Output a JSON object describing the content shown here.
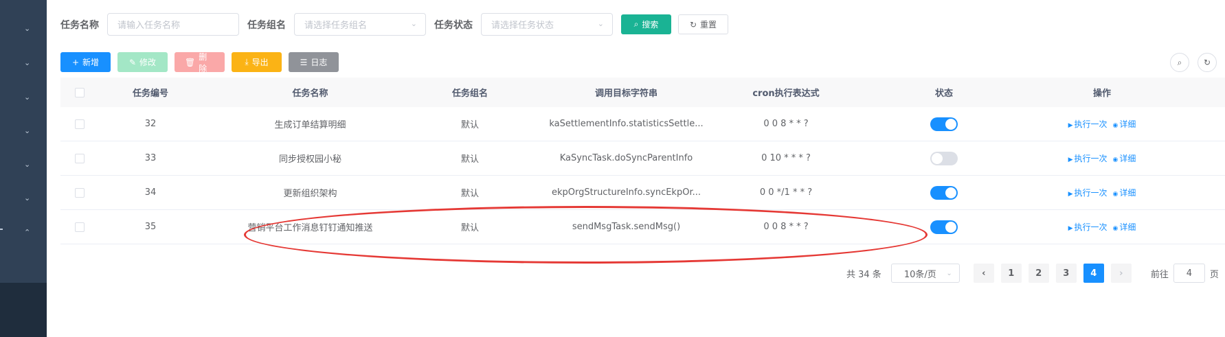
{
  "search": {
    "task_name_label": "任务名称",
    "task_name_placeholder": "请输入任务名称",
    "task_group_label": "任务组名",
    "task_group_placeholder": "请选择任务组名",
    "task_status_label": "任务状态",
    "task_status_placeholder": "请选择任务状态",
    "search_button": "搜索",
    "reset_button": "重置"
  },
  "toolbar": {
    "add": "新增",
    "edit": "修改",
    "delete": "删除",
    "export": "导出",
    "log": "日志"
  },
  "table": {
    "headers": [
      "任务编号",
      "任务名称",
      "任务组名",
      "调用目标字符串",
      "cron执行表达式",
      "状态",
      "操作"
    ],
    "rows": [
      {
        "id": "32",
        "name": "生成订单结算明细",
        "group": "默认",
        "target": "kaSettlementInfo.statisticsSettle...",
        "cron": "0 0 8 * * ?",
        "enabled": true
      },
      {
        "id": "33",
        "name": "同步授权园小秘",
        "group": "默认",
        "target": "KaSyncTask.doSyncParentInfo",
        "cron": "0 10 * * * ?",
        "enabled": false
      },
      {
        "id": "34",
        "name": "更新组织架构",
        "group": "默认",
        "target": "ekpOrgStructureInfo.syncEkpOr...",
        "cron": "0 0 */1 * * ?",
        "enabled": true
      },
      {
        "id": "35",
        "name": "营销平台工作消息钉钉通知推送",
        "group": "默认",
        "target": "sendMsgTask.sendMsg()",
        "cron": "0 0 8 * * ?",
        "enabled": true
      }
    ],
    "op_run_once": "执行一次",
    "op_detail": "详细"
  },
  "pagination": {
    "total": "共 34 条",
    "page_size": "10条/页",
    "pages": [
      "1",
      "2",
      "3",
      "4"
    ],
    "current": "4",
    "goto_label": "前往",
    "goto_value": "4",
    "page_suffix": "页"
  },
  "colors": {
    "primary": "#1890ff",
    "search": "#1ab394",
    "annotation": "#e53935"
  }
}
